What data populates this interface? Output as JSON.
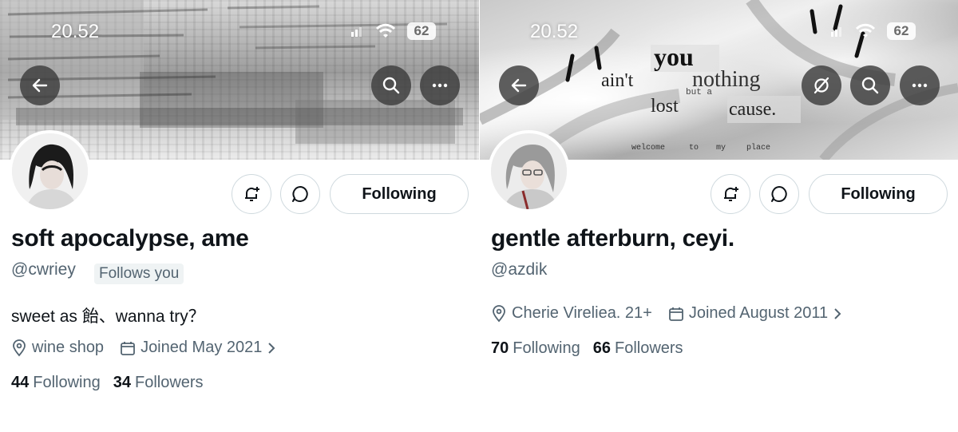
{
  "profiles": [
    {
      "status": {
        "time": "20.52",
        "battery": "62"
      },
      "display_name": "soft apocalypse, ame",
      "handle": "@cwriey",
      "follows_you": "Follows you",
      "bio": "sweet as 飴、wanna try？",
      "location": "wine shop",
      "joined": "Joined May 2021",
      "following_count": "44",
      "following_label": "Following",
      "followers_count": "34",
      "followers_label": "Followers",
      "follow_button": "Following",
      "icons": [
        "back-arrow-icon",
        "search-icon",
        "more-icon",
        "bell-plus-icon",
        "message-icon",
        "location-pin-icon",
        "calendar-icon",
        "chevron-right-icon"
      ]
    },
    {
      "status": {
        "time": "20.52",
        "battery": "62"
      },
      "display_name": "gentle afterburn, ceyi.",
      "handle": "@azdik",
      "location": "Cherie Vireliea. 21+",
      "joined": "Joined August 2011",
      "following_count": "70",
      "following_label": "Following",
      "followers_count": "66",
      "followers_label": "Followers",
      "follow_button": "Following",
      "banner_text": [
        "ain't",
        "you",
        "nothing",
        "but a",
        "lost",
        "cause.",
        "welcome",
        "to",
        "my",
        "place"
      ],
      "icons": [
        "back-arrow-icon",
        "grok-icon",
        "search-icon",
        "more-icon",
        "bell-plus-icon",
        "message-icon",
        "location-pin-icon",
        "calendar-icon",
        "chevron-right-icon"
      ]
    }
  ],
  "colors": {
    "text": "#0f1419",
    "secondary": "#536471",
    "border": "#cfd9de",
    "badge_bg": "#eff3f4"
  }
}
